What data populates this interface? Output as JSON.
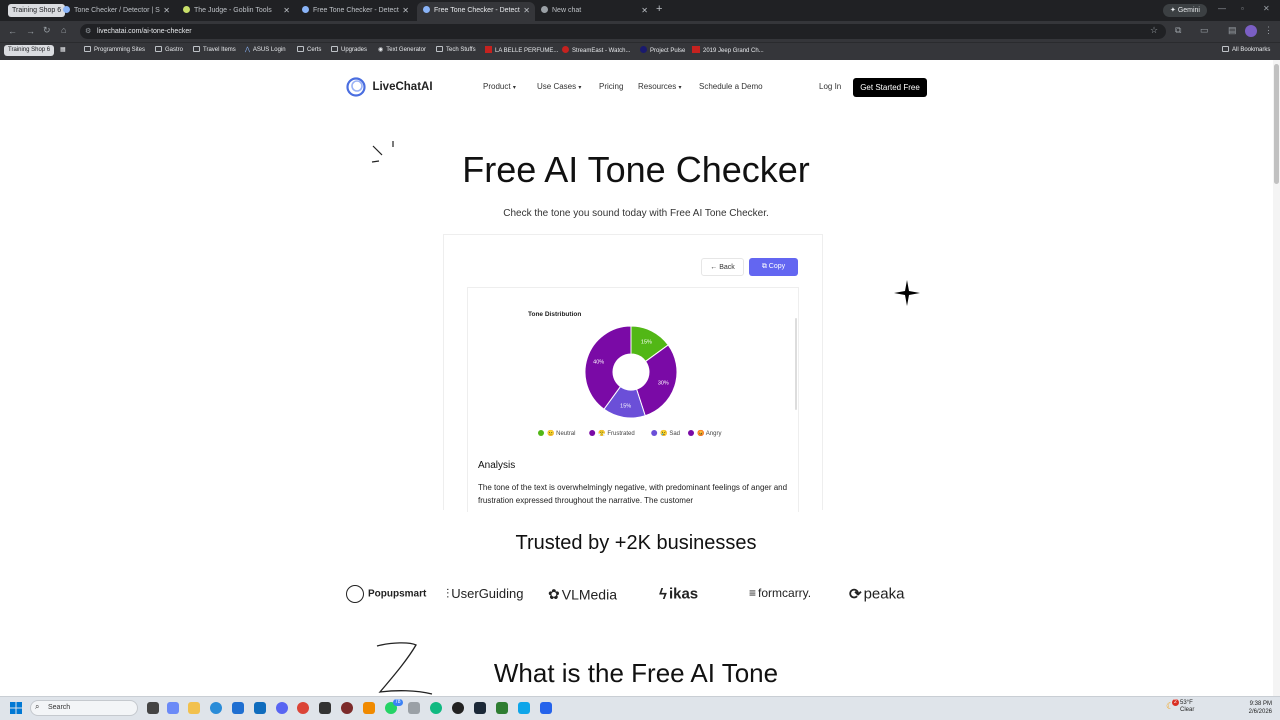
{
  "browser": {
    "tab_group": "Training Shop 6",
    "tabs": [
      {
        "title": "Tone Checker / Detector | Sapl",
        "color": "#8ab4f8"
      },
      {
        "title": "The Judge - Goblin Tools",
        "color": "#c8e06a"
      },
      {
        "title": "Free Tone Checker - Detect Ton",
        "color": "#8ab4f8"
      },
      {
        "title": "Free Tone Checker - Detect Ton",
        "color": "#8ab4f8",
        "active": true
      },
      {
        "title": "New chat",
        "color": "#9aa0a6"
      }
    ],
    "gemini_label": "Gemini",
    "url": "livechatai.com/ai-tone-checker",
    "bookmarks_group": "Training Shop 6",
    "bookmarks": [
      "Programming Sites",
      "Gastro",
      "Travel Items",
      "ASUS Login",
      "Certs",
      "Upgrades",
      "Text Generator",
      "Tech Stuffs",
      "LA BELLE PERFUME...",
      "StreamEast - Watch...",
      "Project Pulse",
      "2019 Jeep Grand Ch..."
    ],
    "all_bookmarks": "All Bookmarks"
  },
  "site": {
    "logo": "LiveChatAI",
    "nav": {
      "product": "Product",
      "use_cases": "Use Cases",
      "pricing": "Pricing",
      "resources": "Resources",
      "demo": "Schedule a Demo"
    },
    "login": "Log In",
    "cta": "Get Started Free"
  },
  "hero": {
    "title": "Free AI Tone Checker",
    "subtitle": "Check the tone you sound today with Free AI Tone Checker."
  },
  "result": {
    "back_label": "Back",
    "copy_label": "Copy",
    "analysis_heading": "Analysis",
    "analysis_text": "The tone of the text is overwhelmingly negative, with predominant feelings of anger and frustration expressed throughout the narrative. The customer"
  },
  "chart_data": {
    "type": "pie",
    "title": "Tone Distribution",
    "categories": [
      "Neutral",
      "Angry",
      "Sad",
      "Frustrated"
    ],
    "values": [
      15,
      30,
      15,
      40
    ],
    "labels": [
      "15%",
      "30%",
      "15%",
      "40%"
    ],
    "colors": [
      "#52b716",
      "#7a0aa6",
      "#6b4fd8",
      "#7a0aa6"
    ],
    "legend": [
      {
        "name": "Neutral",
        "emoji": "😐",
        "color": "#52b716"
      },
      {
        "name": "Frustrated",
        "emoji": "😤",
        "color": "#7a0aa6"
      },
      {
        "name": "Sad",
        "emoji": "😢",
        "color": "#6b4fd8"
      },
      {
        "name": "Angry",
        "emoji": "😡",
        "color": "#7a0aa6"
      }
    ],
    "legend_position": "bottom"
  },
  "trusted": {
    "heading": "Trusted by +2K businesses",
    "logos": [
      "Popupsmart",
      "UserGuiding",
      "VLMedia",
      "ikas",
      "formcarry.",
      "peaka"
    ]
  },
  "section2": {
    "title": "What is the Free AI Tone"
  },
  "taskbar": {
    "search": "Search",
    "weather": {
      "temp": "53°F",
      "desc": "Clear",
      "badge": "2"
    },
    "time": "9:38 PM",
    "date": "2/6/2026",
    "badge_count": "78"
  }
}
